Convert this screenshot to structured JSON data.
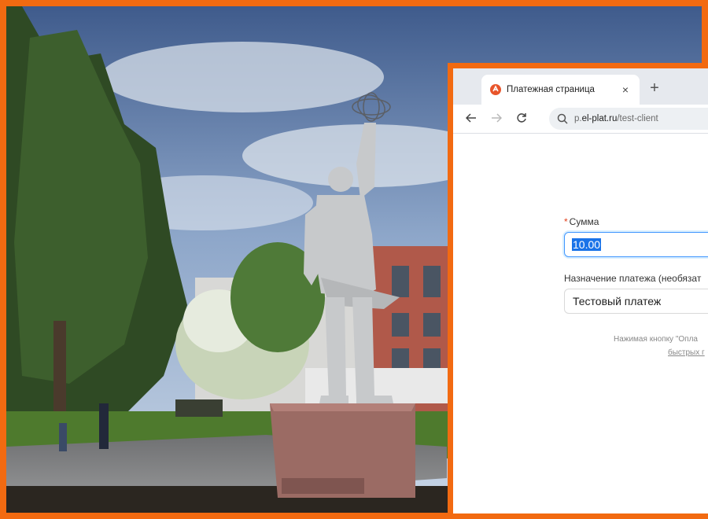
{
  "browser": {
    "tab": {
      "title": "Платежная страница",
      "close": "×"
    },
    "new_tab": "+",
    "url_prefix": "p.",
    "url_domain": "el-plat.ru",
    "url_path": "/test-client"
  },
  "form": {
    "amount_required_mark": "*",
    "amount_label": "Сумма",
    "amount_value": "10.00",
    "purpose_label": "Назначение платежа (необязат",
    "purpose_value": "Тестовый платеж",
    "hint_line1": "Нажимая кнопку \"Опла",
    "hint_link": "быстрых г"
  },
  "colors": {
    "frame_accent": "#f26a11",
    "favicon": "#e8552b",
    "selection": "#1a73e8"
  }
}
